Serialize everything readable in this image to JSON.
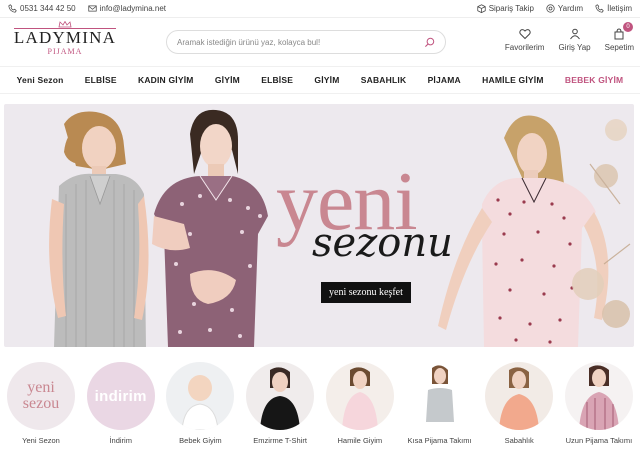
{
  "topbar": {
    "phone": "0531 344 42 50",
    "email": "info@ladymina.net",
    "order_track": "Sipariş Takip",
    "help": "Yardım",
    "contact": "İletişim"
  },
  "logo": {
    "brand": "LadyMina",
    "sub": "PIJAMA"
  },
  "search": {
    "placeholder": "Aramak istediğin ürünü yaz, kolayca bul!"
  },
  "header_icons": {
    "favorites": "Favorilerim",
    "login": "Giriş Yap",
    "cart": "Sepetim",
    "cart_count": "0"
  },
  "nav": [
    "Yeni Sezon",
    "ELBİSE",
    "KADIN GİYİM",
    "GİYİM",
    "ELBİSE",
    "GİYİM",
    "SABAHLIK",
    "PİJAMA",
    "HAMİLE GİYİM",
    "BEBEK GİYİM"
  ],
  "hero": {
    "title": "yeni",
    "subtitle": "sezonu",
    "cta": "yeni sezonu keşfet"
  },
  "categories": [
    {
      "label": "Yeni Sezon",
      "tile_text": "yeni sezou"
    },
    {
      "label": "İndirim",
      "tile_text": "indirim"
    },
    {
      "label": "Bebek Giyim"
    },
    {
      "label": "Emzirme T-Shirt"
    },
    {
      "label": "Hamile Giyim"
    },
    {
      "label": "Kısa Pijama Takımı"
    },
    {
      "label": "Sabahlık"
    },
    {
      "label": "Uzun Pijama Takımı"
    }
  ],
  "colors": {
    "brand": "#c0547f",
    "hero_bg": "#ede9ee",
    "title_pink": "#c98791"
  }
}
